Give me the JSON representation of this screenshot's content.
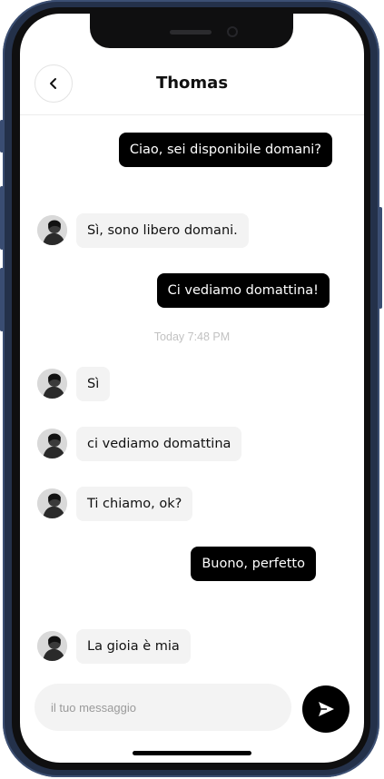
{
  "header": {
    "contact_name": "Thomas",
    "back_icon": "chevron-left-icon"
  },
  "messages": [
    {
      "direction": "out",
      "text": "Ciao, sei disponibile domani?"
    },
    {
      "direction": "in",
      "text": "Sì, sono libero domani."
    },
    {
      "direction": "out",
      "text": "Ci vediamo domattina!"
    },
    {
      "direction": "in",
      "text": "Sì"
    },
    {
      "direction": "in",
      "text": "ci vediamo domattina"
    },
    {
      "direction": "in",
      "text": "Ti chiamo, ok?"
    },
    {
      "direction": "out",
      "text": "Buono, perfetto"
    },
    {
      "direction": "in",
      "text": "La gioia è mia"
    }
  ],
  "timestamp": "Today 7:48 PM",
  "composer": {
    "placeholder": "il tuo messaggio",
    "send_icon": "send-icon"
  },
  "colors": {
    "outgoing_bubble": "#000000",
    "incoming_bubble": "#f3f3f3",
    "phone_frame": "#24314a"
  }
}
